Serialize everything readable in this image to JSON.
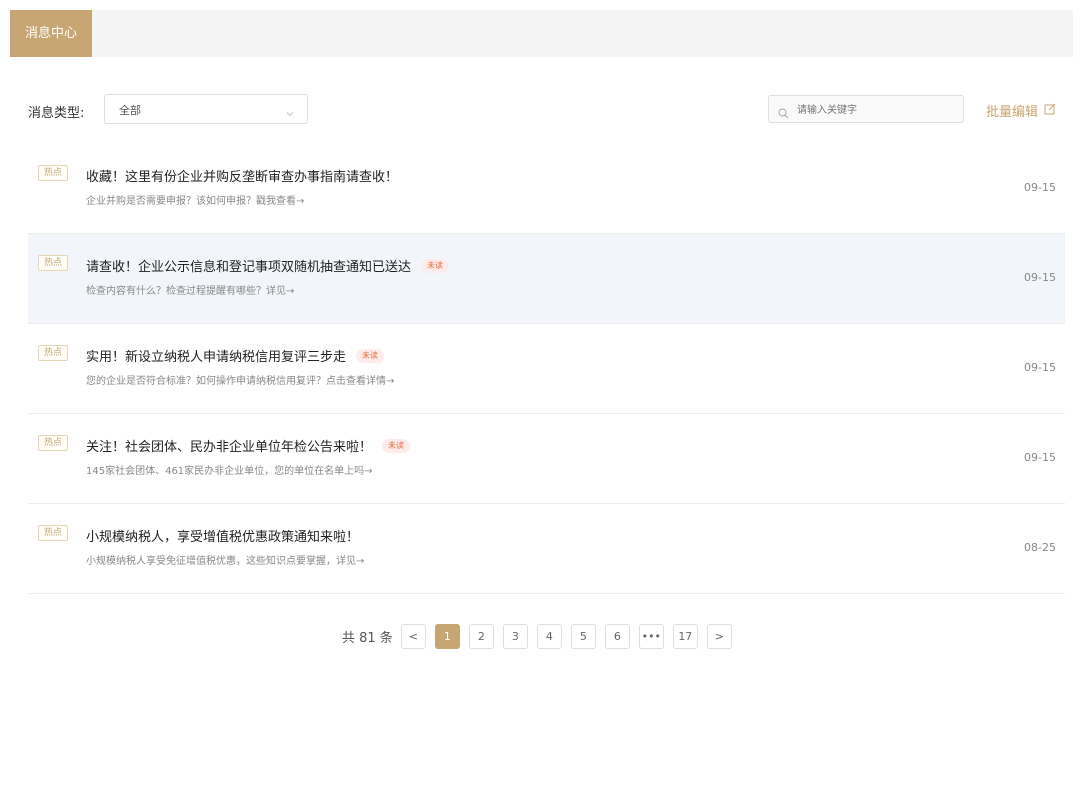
{
  "tabs": {
    "active_label": "消息中心"
  },
  "filter": {
    "label": "消息类型:",
    "selected": "全部"
  },
  "search": {
    "placeholder": "请输入关键字"
  },
  "batch_edit": {
    "label": "批量编辑"
  },
  "messages": [
    {
      "tag": "热点",
      "title": "收藏！这里有份企业并购反垄断审查办事指南请查收！",
      "subtitle": "企业并购是否需要申报？该如何申报？戳我查看→",
      "unread": "",
      "date": "09-15"
    },
    {
      "tag": "热点",
      "title": "请查收！企业公示信息和登记事项双随机抽查通知已送达",
      "subtitle": "检查内容有什么？检查过程提醒有哪些？详见→",
      "unread": "未读",
      "date": "09-15"
    },
    {
      "tag": "热点",
      "title": "实用！新设立纳税人申请纳税信用复评三步走",
      "subtitle": "您的企业是否符合标准？如何操作申请纳税信用复评？点击查看详情→",
      "unread": "未读",
      "date": "09-15"
    },
    {
      "tag": "热点",
      "title": "关注！社会团体、民办非企业单位年检公告来啦！",
      "subtitle": "145家社会团体、461家民办非企业单位，您的单位在名单上吗→",
      "unread": "未读",
      "date": "09-15"
    },
    {
      "tag": "热点",
      "title": "小规模纳税人，享受增值税优惠政策通知来啦！",
      "subtitle": "小规模纳税人享受免征增值税优惠，这些知识点要掌握，详见→",
      "unread": "",
      "date": "08-25"
    }
  ],
  "pagination": {
    "total_text": "共 81 条",
    "prev": "<",
    "next": ">",
    "pages": [
      "1",
      "2",
      "3",
      "4",
      "5",
      "6",
      "•••",
      "17"
    ],
    "active": "1"
  },
  "colors": {
    "accent": "#c7a673",
    "unread": "#e86c3c",
    "highlight_row": "#f2f5f9"
  }
}
